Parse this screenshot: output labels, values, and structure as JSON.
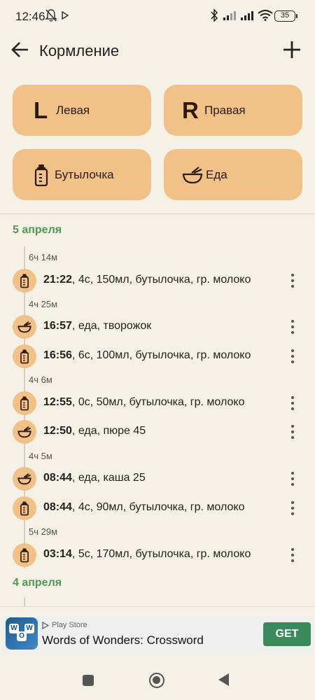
{
  "status_bar": {
    "time": "12:46",
    "battery": "35"
  },
  "app_bar": {
    "title": "Кормление"
  },
  "actions": {
    "left": {
      "letter": "L",
      "label": "Левая"
    },
    "right": {
      "letter": "R",
      "label": "Правая"
    },
    "bottle": {
      "label": "Бутылочка"
    },
    "food": {
      "label": "Еда"
    }
  },
  "feed": {
    "days": [
      {
        "date": "5 апреля",
        "gaps": [
          "6ч 14м",
          "4ч 25м",
          "4ч 6м",
          "4ч 5м",
          "5ч 29м"
        ],
        "entries": [
          {
            "time": "21:22",
            "details": ", 4с, 150мл, бутылочка, гр. молоко",
            "icon": "bottle-icon"
          },
          {
            "time": "16:57",
            "details": ", еда, творожок",
            "icon": "bowl-icon"
          },
          {
            "time": "16:56",
            "details": ", 6с, 100мл, бутылочка, гр. молоко",
            "icon": "bottle-icon"
          },
          {
            "time": "12:55",
            "details": ", 0с, 50мл, бутылочка, гр. молоко",
            "icon": "bottle-icon"
          },
          {
            "time": "12:50",
            "details": ", еда, пюре 45",
            "icon": "bowl-icon"
          },
          {
            "time": "08:44",
            "details": ", еда, каша 25",
            "icon": "bowl-icon"
          },
          {
            "time": "08:44",
            "details": ", 4с, 90мл, бутылочка, гр. молоко",
            "icon": "bottle-icon"
          },
          {
            "time": "03:14",
            "details": ", 5с, 170мл, бутылочка, гр. молоко",
            "icon": "bottle-icon"
          }
        ]
      },
      {
        "date": "4 апреля",
        "gaps": [],
        "entries": []
      }
    ]
  },
  "ad": {
    "store": "Play Store",
    "title": "Words of Wonders: Crossword",
    "cta": "GET",
    "logo_letters": [
      "W",
      "O",
      "W"
    ]
  },
  "colors": {
    "background": "#f6f1e6",
    "button": "#f1c188",
    "date_header": "#4f9b52",
    "ad_cta": "#3a8a5b"
  }
}
